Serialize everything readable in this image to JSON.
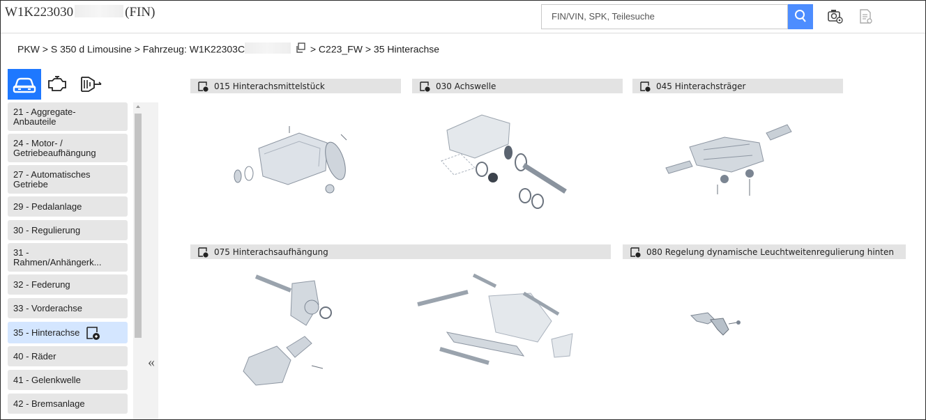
{
  "header": {
    "title_prefix": "W1K223030",
    "title_suffix": "(FIN)",
    "search_placeholder": "FIN/VIN, SPK, Teilesuche",
    "icons": [
      "search-icon",
      "camera-settings-icon",
      "document-search-icon"
    ]
  },
  "breadcrumb": {
    "part1": "PKW > S 350 d Limousine > Fahrzeug: W1K22303C",
    "part2": "> C223_FW",
    "part3": "> 35 Hinterachse",
    "copy_icon": "copy-icon"
  },
  "vehicle_tabs": [
    "car-icon",
    "engine-icon",
    "transmission-icon"
  ],
  "sidebar": {
    "items": [
      {
        "label": "21 - Aggregate-\nAnbauteile"
      },
      {
        "label": "24 - Motor- /\nGetriebeaufhängung"
      },
      {
        "label": "27 - Automatisches\nGetriebe"
      },
      {
        "label": "29 - Pedalanlage"
      },
      {
        "label": "30 - Regulierung"
      },
      {
        "label": "31 -\nRahmen/Anhängerk..."
      },
      {
        "label": "32 - Federung"
      },
      {
        "label": "33 - Vorderachse"
      },
      {
        "label": "35 - Hinterachse"
      },
      {
        "label": "40 - Räder"
      },
      {
        "label": "41 - Gelenkwelle"
      },
      {
        "label": "42 - Bremsanlage"
      }
    ],
    "collapse_label": "«"
  },
  "groups": [
    {
      "label": "015 Hinterachsmittelstück"
    },
    {
      "label": "030 Achswelle"
    },
    {
      "label": "045 Hinterachsträger"
    },
    {
      "label": "075 Hinterachsaufhängung"
    },
    {
      "label": "080 Regelung dynamische Leuchtweitenregulierung hinten"
    }
  ],
  "colors": {
    "accent": "#1e78ff",
    "search_button": "#4d8dff",
    "active_item": "#d4e6ff"
  }
}
